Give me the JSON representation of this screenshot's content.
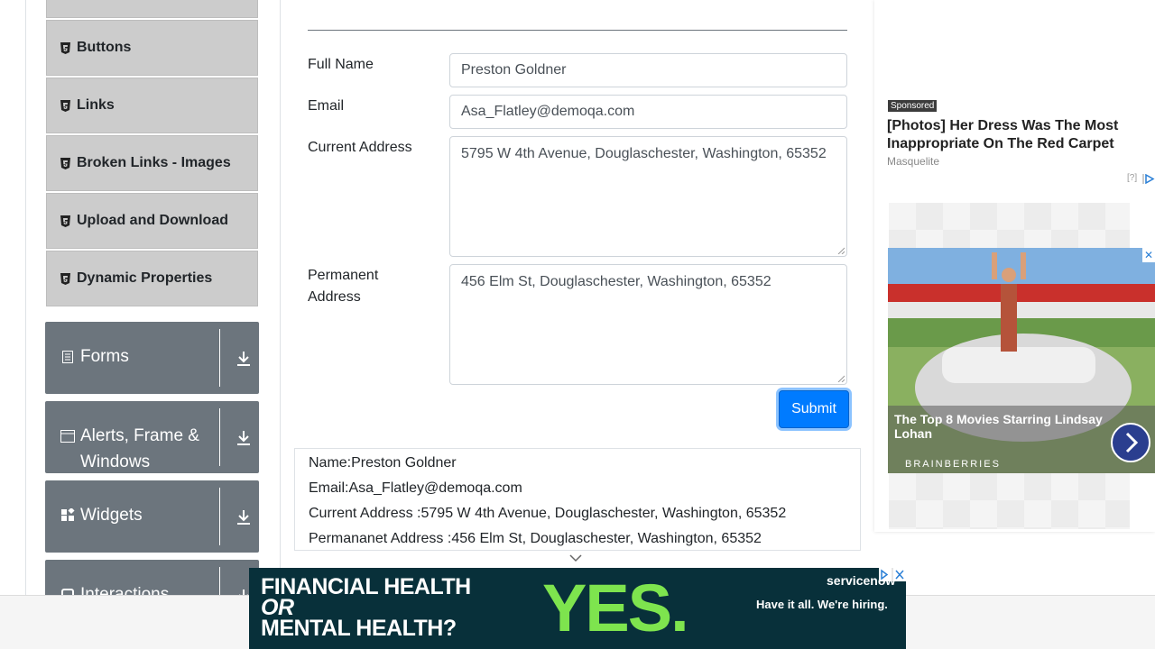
{
  "sidebar": {
    "sub_items": [
      {
        "label": "Buttons"
      },
      {
        "label": "Links"
      },
      {
        "label": "Broken Links - Images"
      },
      {
        "label": "Upload and Download"
      },
      {
        "label": "Dynamic Properties"
      }
    ],
    "groups": [
      {
        "label": "Forms",
        "icon": "form-icon"
      },
      {
        "label": "Alerts, Frame & Windows",
        "icon": "window-icon"
      },
      {
        "label": "Widgets",
        "icon": "widgets-icon"
      },
      {
        "label": "Interactions",
        "icon": "interactions-icon"
      }
    ]
  },
  "form": {
    "full_name_label": "Full Name",
    "full_name_value": "Preston Goldner",
    "email_label": "Email",
    "email_value": "Asa_Flatley@demoqa.com",
    "current_address_label": "Current Address",
    "current_address_value": "5795 W 4th Avenue, Douglaschester, Washington, 65352",
    "permanent_address_label": "Permanent Address",
    "permanent_address_value": "456 Elm St, Douglaschester, Washington, 65352",
    "submit_label": "Submit",
    "brand_color": "#007bff"
  },
  "output": {
    "name": "Name:Preston Goldner",
    "email": "Email:Asa_Flatley@demoqa.com",
    "current_address": "Current Address :5795 W 4th Avenue, Douglaschester, Washington, 65352",
    "permanent_address": "Permananet Address :456 Elm St, Douglaschester, Washington, 65352"
  },
  "ads": {
    "sponsored": "Sponsored",
    "headline": "[Photos] Her Dress Was The Most Inappropriate On The Red Carpet",
    "source": "Masquelite",
    "help": "[?]",
    "image_caption": "The Top 8 Movies Starring Lindsay Lohan",
    "image_brand": "BRAINBERRIES",
    "close": "✕"
  },
  "bottom_ad": {
    "line1": "FINANCIAL HEALTH",
    "line2": "OR",
    "line3": "MENTAL HEALTH?",
    "big": "YES.",
    "logo": "servicenow",
    "tagline": "Have it all. We're hiring."
  }
}
